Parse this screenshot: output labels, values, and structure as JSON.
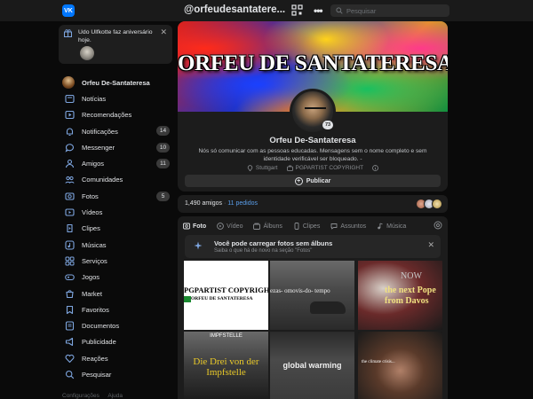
{
  "topbar": {
    "logo": "VK",
    "page_handle": "@orfeudesantatere...",
    "more": "•••",
    "search_placeholder": "Pesquisar"
  },
  "notification": {
    "text": "Udo Ulfkotte faz aniversário hoje.",
    "close": "✕"
  },
  "sidebar": {
    "profile_name": "Orfeu De-Santateresa",
    "items": [
      {
        "label": "Notícias",
        "icon": "news-icon"
      },
      {
        "label": "Recomendações",
        "icon": "recommendations-icon"
      },
      {
        "label": "Notificações",
        "icon": "bell-icon",
        "badge": "14"
      },
      {
        "label": "Messenger",
        "icon": "messenger-icon",
        "badge": "10"
      },
      {
        "label": "Amigos",
        "icon": "friends-icon",
        "badge": "11"
      },
      {
        "label": "Comunidades",
        "icon": "communities-icon"
      },
      {
        "label": "Fotos",
        "icon": "photos-icon",
        "badge": "5"
      },
      {
        "label": "Vídeos",
        "icon": "videos-icon"
      },
      {
        "label": "Clipes",
        "icon": "clips-icon"
      },
      {
        "label": "Músicas",
        "icon": "music-icon"
      },
      {
        "label": "Serviços",
        "icon": "services-icon"
      },
      {
        "label": "Jogos",
        "icon": "games-icon"
      },
      {
        "label": "Market",
        "icon": "market-icon"
      },
      {
        "label": "Favoritos",
        "icon": "bookmark-icon"
      },
      {
        "label": "Documentos",
        "icon": "documents-icon"
      },
      {
        "label": "Publicidade",
        "icon": "ads-icon"
      },
      {
        "label": "Reações",
        "icon": "reactions-icon"
      },
      {
        "label": "Pesquisar",
        "icon": "search-icon"
      }
    ],
    "footer": {
      "settings": "Configurações",
      "help": "Ajuda"
    }
  },
  "profile": {
    "cover_title": "ORFEU DE SANTATERESA",
    "avatar_badge": "73",
    "name": "Orfeu De-Santateresa",
    "bio": "Nós só comunicar com as pessoas educadas. Mensagens sem o nome completo e sem identidade verificável ser bloqueado. -",
    "location": "Stuttgart",
    "copyright": "PGPARTIST COPYRIGHT",
    "publish_label": "Publicar"
  },
  "friends": {
    "count": "1,490 amigos",
    "separator": "·",
    "pending": "11 pedidos"
  },
  "media": {
    "tabs": [
      {
        "label": "Foto",
        "icon": "photo-tab-icon",
        "active": true
      },
      {
        "label": "Vídeo",
        "icon": "video-tab-icon",
        "active": false
      },
      {
        "label": "Álbuns",
        "icon": "albums-tab-icon",
        "active": false
      },
      {
        "label": "Clipes",
        "icon": "clips-tab-icon",
        "active": false
      },
      {
        "label": "Assuntos",
        "icon": "topics-tab-icon",
        "active": false
      },
      {
        "label": "Música",
        "icon": "music-tab-icon",
        "active": false
      }
    ],
    "banner_title": "Você pode carregar fotos sem álbuns",
    "banner_subtitle": "Saiba o que há de novo na seção \"Fotos\"",
    "photos": [
      {
        "caption": "PGPARTIST COPYRIGHT",
        "subcaption": "ORFEU DE SANTATERESA"
      },
      {
        "caption": "ezas- omovis-do- tempo"
      },
      {
        "caption_a": "NOW",
        "caption_b": "the next Pope from Davos"
      },
      {
        "caption": "Die Drei von der Impfstelle",
        "topline": "IMPFSTELLE"
      },
      {
        "caption": "global warming"
      },
      {
        "caption": "the climate crisis..."
      }
    ]
  },
  "colors": {
    "accent": "#0077ff",
    "link": "#5a9eea",
    "background": "#0a0a0a",
    "card": "#1c1c1c"
  }
}
